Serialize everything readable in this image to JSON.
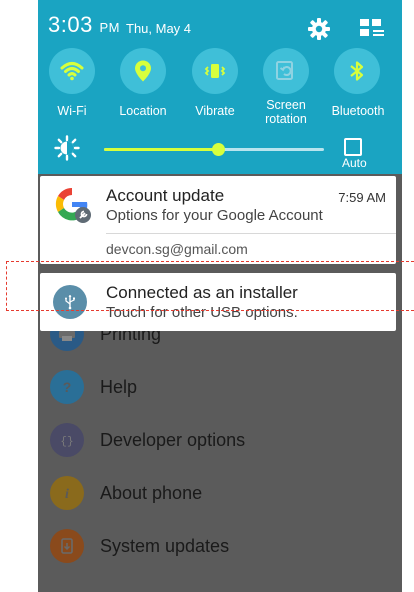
{
  "status_bar": {
    "time": "3:03",
    "ampm": "PM",
    "date": "Thu, May 4"
  },
  "quick_settings": {
    "tiles": [
      {
        "label": "Wi-Fi",
        "icon": "wifi-icon",
        "active": true
      },
      {
        "label": "Location",
        "icon": "location-icon",
        "active": true
      },
      {
        "label": "Vibrate",
        "icon": "vibrate-icon",
        "active": true
      },
      {
        "label": "Screen rotation",
        "icon": "screen-rotation-icon",
        "active": false
      },
      {
        "label": "Bluetooth",
        "icon": "bluetooth-icon",
        "active": true
      }
    ],
    "brightness": {
      "level": 0.52,
      "auto_label": "Auto"
    }
  },
  "notifications": {
    "account": {
      "title": "Account update",
      "time": "7:59 AM",
      "subtitle": "Options for your Google Account",
      "email": "devcon.sg@gmail.com"
    },
    "usb": {
      "title": "Connected as an installer",
      "subtitle": "Touch for other USB options."
    }
  },
  "settings_items": [
    {
      "label": "Printing",
      "icon": "printer-icon",
      "color": "#2a5a86"
    },
    {
      "label": "Help",
      "icon": "help-icon",
      "color": "#2a6f97"
    },
    {
      "label": "Developer options",
      "icon": "developer-options-icon",
      "color": "#4a4a66"
    },
    {
      "label": "About phone",
      "icon": "info-icon",
      "color": "#8a6a1c"
    },
    {
      "label": "System updates",
      "icon": "system-update-icon",
      "color": "#8a4a1c"
    }
  ],
  "colors": {
    "shade": "#1aa4c2",
    "tile_active": "#d7ff3c",
    "highlight_dash": "#e53b2f"
  }
}
